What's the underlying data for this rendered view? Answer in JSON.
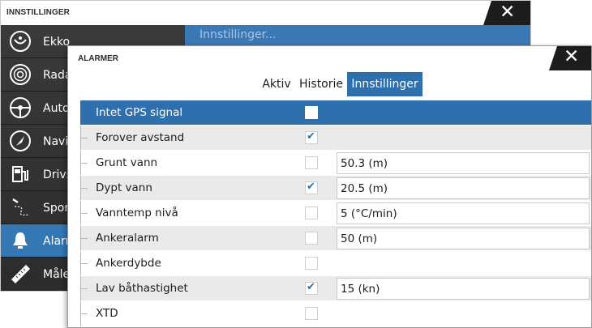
{
  "back_dialog": {
    "title": "INNSTILLINGER",
    "header_text": "Innstillinger...",
    "sidebar": [
      {
        "label": "Ekko",
        "icon": "echo-icon"
      },
      {
        "label": "Radar",
        "icon": "radar-icon"
      },
      {
        "label": "Autopilot",
        "icon": "autopilot-icon"
      },
      {
        "label": "Navigasjon",
        "icon": "navigation-icon"
      },
      {
        "label": "Drivstoff",
        "icon": "fuel-icon"
      },
      {
        "label": "Spor og ruter",
        "icon": "tracks-icon"
      },
      {
        "label": "Alarmer",
        "icon": "alarm-bell-icon"
      },
      {
        "label": "Måleenheter",
        "icon": "ruler-icon"
      }
    ],
    "active_item_index": 6
  },
  "front_dialog": {
    "title": "ALARMER",
    "tabs": [
      {
        "label": "Aktiv"
      },
      {
        "label": "Historie"
      },
      {
        "label": "Innstillinger"
      }
    ],
    "active_tab_index": 2,
    "rows": [
      {
        "label": "Intet GPS signal",
        "checked": false,
        "value": null
      },
      {
        "label": "Forover avstand",
        "checked": true,
        "value": null
      },
      {
        "label": "Grunt vann",
        "checked": false,
        "value": "50.3 (m)"
      },
      {
        "label": "Dypt vann",
        "checked": true,
        "value": "20.5 (m)"
      },
      {
        "label": "Vanntemp nivå",
        "checked": false,
        "value": "5 (°C/min)"
      },
      {
        "label": "Ankeralarm",
        "checked": false,
        "value": "50 (m)"
      },
      {
        "label": "Ankerdybde",
        "checked": false,
        "value": null
      },
      {
        "label": "Lav båthastighet",
        "checked": true,
        "value": "15 (kn)"
      },
      {
        "label": "XTD",
        "checked": false,
        "value": null
      }
    ],
    "selected_row_index": 0
  },
  "colors": {
    "accent_blue": "#2e6fae",
    "sidebar_dark": "#333333",
    "close_tab": "#1d1d1d"
  }
}
